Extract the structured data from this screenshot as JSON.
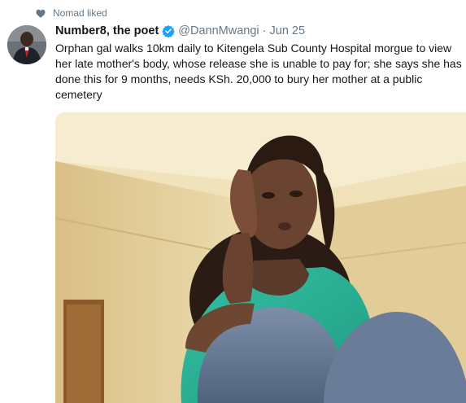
{
  "social_context": {
    "icon": "heart-icon",
    "text": "Nomad liked"
  },
  "tweet": {
    "author": {
      "display_name": "Number8, the poet",
      "verified": true,
      "handle": "@DannMwangi",
      "avatar_icon": "avatar"
    },
    "separator": "·",
    "date": "Jun 25",
    "text": "Orphan gal walks 10km daily to Kitengela Sub County Hospital morgue to view her late mother's body, whose release she is unable to pay for; she says she has done this for 9 months, needs KSh. 20,000 to bury her mother at a public cemetery",
    "media": {
      "type": "photo"
    }
  },
  "colors": {
    "secondary_text": "#657786",
    "primary_text": "#14171a",
    "verified_blue": "#1da1f2",
    "heart_gray": "#657786"
  }
}
